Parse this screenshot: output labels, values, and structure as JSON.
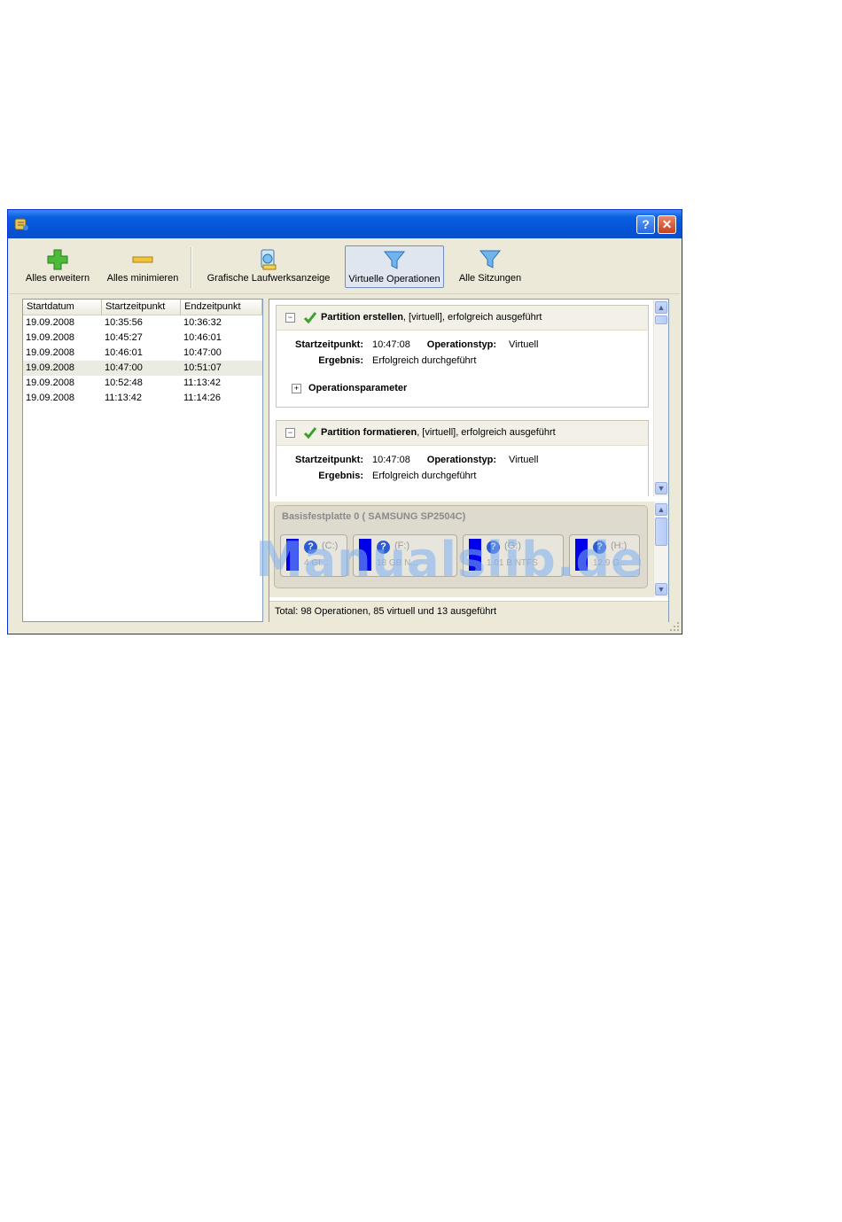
{
  "window": {
    "help_label": "?",
    "close_label": "✕"
  },
  "toolbar": {
    "expand_all": "Alles erweitern",
    "collapse_all": "Alles minimieren",
    "graphic_view": "Grafische Laufwerksanzeige",
    "virtual_ops": "Virtuelle Operationen",
    "all_sessions": "Alle Sitzungen"
  },
  "sessions": {
    "columns": [
      "Startdatum",
      "Startzeitpunkt",
      "Endzeitpunkt"
    ],
    "rows": [
      [
        "19.09.2008",
        "10:35:56",
        "10:36:32"
      ],
      [
        "19.09.2008",
        "10:45:27",
        "10:46:01"
      ],
      [
        "19.09.2008",
        "10:46:01",
        "10:47:00"
      ],
      [
        "19.09.2008",
        "10:47:00",
        "10:51:07"
      ],
      [
        "19.09.2008",
        "10:52:48",
        "11:13:42"
      ],
      [
        "19.09.2008",
        "11:13:42",
        "11:14:26"
      ]
    ],
    "selected_index": 3
  },
  "operations": [
    {
      "toggle": "−",
      "title_bold": "Partition erstellen",
      "title_rest": ", [virtuell], erfolgreich ausgeführt",
      "start_label": "Startzeitpunkt:",
      "start_value": "10:47:08",
      "type_label": "Operationstyp:",
      "type_value": "Virtuell",
      "result_label": "Ergebnis:",
      "result_value": "Erfolgreich durchgeführt",
      "params_toggle": "+",
      "params_label": "Operationsparameter"
    },
    {
      "toggle": "−",
      "title_bold": "Partition formatieren",
      "title_rest": ", [virtuell], erfolgreich ausgeführt",
      "start_label": "Startzeitpunkt:",
      "start_value": "10:47:08",
      "type_label": "Operationstyp:",
      "type_value": "Virtuell",
      "result_label": "Ergebnis:",
      "result_value": "Erfolgreich durchgeführt"
    }
  ],
  "disk": {
    "title": "Basisfestplatte 0 ( SAMSUNG SP2504C)",
    "partitions": [
      {
        "name": "(C:)",
        "size": "4 GI..."
      },
      {
        "name": "(F:)",
        "size": "18 GB N..."
      },
      {
        "name": "(G:)",
        "size": "1.01 B NTFS"
      },
      {
        "name": "(H:)",
        "size": "12.9 G..."
      }
    ]
  },
  "status": {
    "text": "Total: 98 Operationen, 85 virtuell und 13 ausgeführt"
  },
  "watermark": "Manualslib.de"
}
